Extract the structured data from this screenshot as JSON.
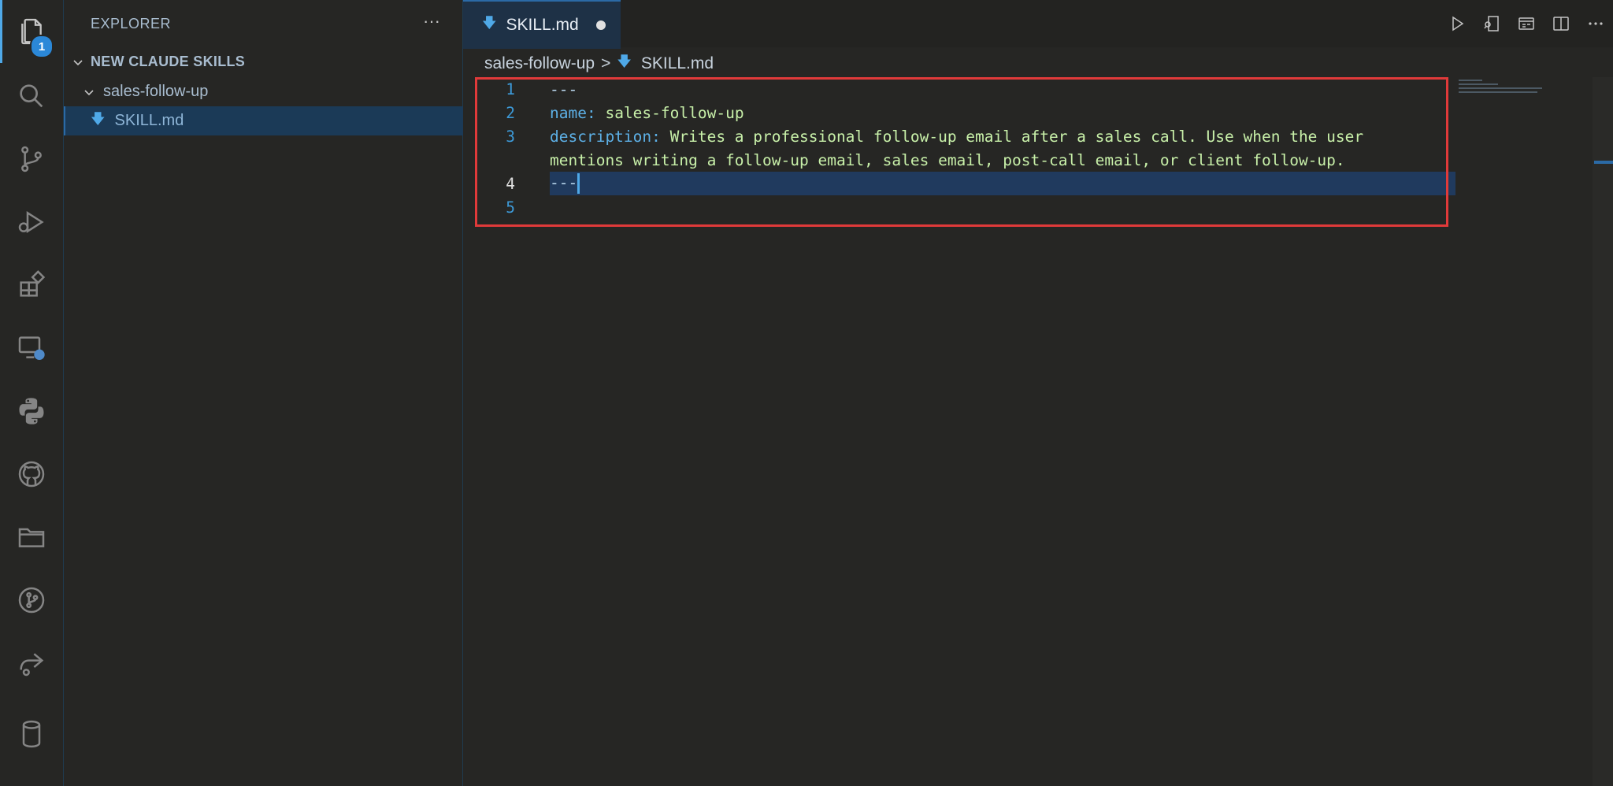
{
  "activity_bar": {
    "items": [
      {
        "icon": "explorer-icon",
        "badge": "1"
      },
      {
        "icon": "search-icon"
      },
      {
        "icon": "source-control-icon"
      },
      {
        "icon": "run-debug-icon"
      },
      {
        "icon": "extensions-icon"
      },
      {
        "icon": "remote-explorer-icon"
      },
      {
        "icon": "python-icon"
      },
      {
        "icon": "github-icon"
      },
      {
        "icon": "folder-icon"
      },
      {
        "icon": "git-graph-icon"
      },
      {
        "icon": "share-icon"
      },
      {
        "icon": "database-icon"
      }
    ]
  },
  "sidebar": {
    "title": "EXPLORER",
    "more": "···",
    "workspace": "NEW CLAUDE SKILLS",
    "folder": "sales-follow-up",
    "file": "SKILL.md"
  },
  "editor": {
    "tab": {
      "label": "SKILL.md",
      "dirty": true
    },
    "breadcrumb": {
      "folder": "sales-follow-up",
      "sep": ">",
      "file": "SKILL.md"
    },
    "lines": [
      {
        "num": "1",
        "text": "---"
      },
      {
        "num": "2",
        "key": "name",
        "value": "sales-follow-up"
      },
      {
        "num": "3",
        "key": "description",
        "value": "Writes a professional follow-up email after a sales call. Use when the user",
        "continuation": "mentions writing a follow-up email, sales email, post-call email, or client follow-up."
      },
      {
        "num": "4",
        "text": "---"
      },
      {
        "num": "5",
        "text": ""
      }
    ],
    "actions": [
      "run-icon",
      "open-preview-icon",
      "preview-icon",
      "split-editor-icon",
      "more-icon"
    ]
  },
  "colors": {
    "accent": "#4fa9e8",
    "highlight_box": "#e03a3a",
    "background": "#262624"
  }
}
